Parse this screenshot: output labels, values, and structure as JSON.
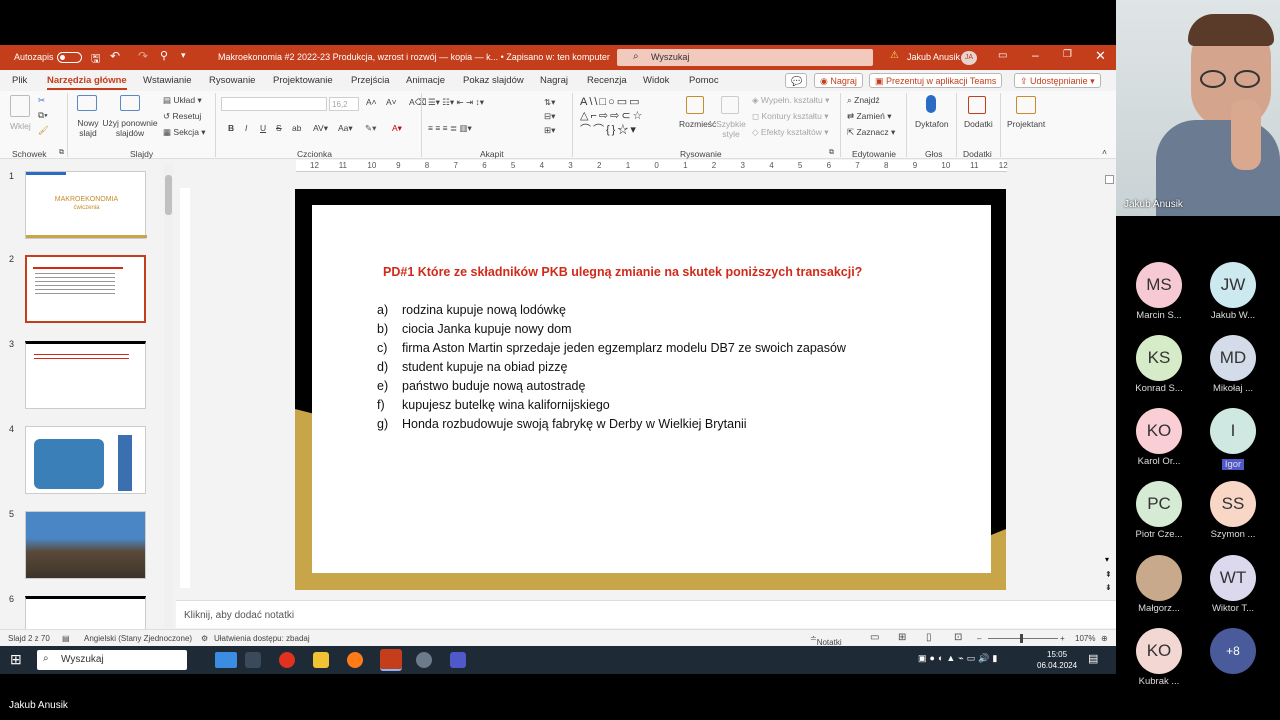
{
  "titlebar": {
    "autosave": "Autozapis",
    "doc_title": "Makroekonomia #2 2022-23 Produkcja, wzrost i rozwój — kopia — k...  •  Zapisano w: ten komputer",
    "search_placeholder": "Wyszukaj",
    "user": "Jakub Anusik",
    "user_initials": "JA"
  },
  "tabs": [
    "Plik",
    "Narzędzia główne",
    "Wstawianie",
    "Rysowanie",
    "Projektowanie",
    "Przejścia",
    "Animacje",
    "Pokaz slajdów",
    "Nagraj",
    "Recenzja",
    "Widok",
    "Pomoc"
  ],
  "tab_buttons": {
    "record": "Nagraj",
    "present_teams": "Prezentuj w aplikacji Teams",
    "share": "Udostępnianie"
  },
  "ribbon": {
    "paste": "Wklej",
    "new_slide": "Nowy slajd",
    "reuse": "Użyj ponownie slajdów",
    "layout": "Układ",
    "reset": "Resetuj",
    "section": "Sekcja",
    "font_name": "",
    "font_size": "16,2",
    "shape_fill": "Wypełn. kształtu",
    "shape_outline": "Kontury kształtu",
    "shape_effects": "Efekty kształtów",
    "arrange": "Rozmieść",
    "quick_styles": "Szybkie style",
    "find": "Znajdź",
    "replace": "Zamień",
    "select": "Zaznacz",
    "dictate": "Dyktafon",
    "addins": "Dodatki",
    "designer": "Projektant",
    "groups": {
      "clipboard": "Schowek",
      "slides": "Slajdy",
      "font": "Czcionka",
      "paragraph": "Akapit",
      "drawing": "Rysowanie",
      "editing": "Edytowanie",
      "voice": "Głos",
      "addins": "Dodatki"
    }
  },
  "ruler_ticks": [
    "12",
    "11",
    "10",
    "9",
    "8",
    "7",
    "6",
    "5",
    "4",
    "3",
    "2",
    "1",
    "0",
    "1",
    "2",
    "3",
    "4",
    "5",
    "6",
    "7",
    "8",
    "9",
    "10",
    "11",
    "12"
  ],
  "thumbnails": [
    {
      "num": "1",
      "title": "MAKROEKONOMIA",
      "subtitle": "ćwiczenia"
    },
    {
      "num": "2"
    },
    {
      "num": "3"
    },
    {
      "num": "4"
    },
    {
      "num": "5"
    },
    {
      "num": "6"
    }
  ],
  "slide": {
    "title": "PD#1 Które ze składników PKB ulegną zmianie na skutek poniższych transakcji?",
    "items": [
      {
        "letter": "a)",
        "text": "rodzina kupuje nową lodówkę"
      },
      {
        "letter": "b)",
        "text": "ciocia Janka kupuje nowy dom"
      },
      {
        "letter": "c)",
        "text": "firma Aston Martin sprzedaje jeden egzemplarz modelu DB7 ze swoich zapasów"
      },
      {
        "letter": "d)",
        "text": "student kupuje na obiad pizzę"
      },
      {
        "letter": "e)",
        "text": "państwo buduje nową autostradę"
      },
      {
        "letter": "f)",
        "text": "kupujesz butelkę wina kalifornijskiego"
      },
      {
        "letter": "g)",
        "text": "Honda rozbudowuje swoją fabrykę w Derby w Wielkiej Brytanii"
      }
    ]
  },
  "notes_placeholder": "Kliknij, aby dodać notatki",
  "status": {
    "slide": "Slajd 2 z 70",
    "language": "Angielski (Stany Zjednoczone)",
    "accessibility": "Ułatwienia dostępu: zbadaj",
    "notes": "Notatki",
    "zoom": "107%"
  },
  "taskbar": {
    "search": "Wyszukaj",
    "time": "15:05",
    "date": "06.04.2024"
  },
  "camera": {
    "name": "Jakub Anusik"
  },
  "participants": [
    {
      "initials": "MS",
      "name": "Marcin S...",
      "color": "#f6c9d4"
    },
    {
      "initials": "JW",
      "name": "Jakub W...",
      "color": "#cbe9ef"
    },
    {
      "initials": "KS",
      "name": "Konrad S...",
      "color": "#d6ecc9"
    },
    {
      "initials": "MD",
      "name": "Mikołaj ...",
      "color": "#d4dbe9"
    },
    {
      "initials": "KO",
      "name": "Karol Or...",
      "color": "#f9cfd5"
    },
    {
      "initials": "I",
      "name": "Igor",
      "color": "#cfe9e2"
    },
    {
      "initials": "PC",
      "name": "Piotr Cze...",
      "color": "#d5ebd3"
    },
    {
      "initials": "SS",
      "name": "Szymon ...",
      "color": "#f9d7c7"
    },
    {
      "initials": "",
      "name": "Małgorz...",
      "color": "#c9a98c"
    },
    {
      "initials": "WT",
      "name": "Wiktor T...",
      "color": "#dcd9ef"
    },
    {
      "initials": "KO",
      "name": "Kubrak ...",
      "color": "#f3d7d3"
    },
    {
      "initials": "+8",
      "name": "",
      "color": "#4a5b9c"
    }
  ],
  "bottom_name": "Jakub Anusik"
}
